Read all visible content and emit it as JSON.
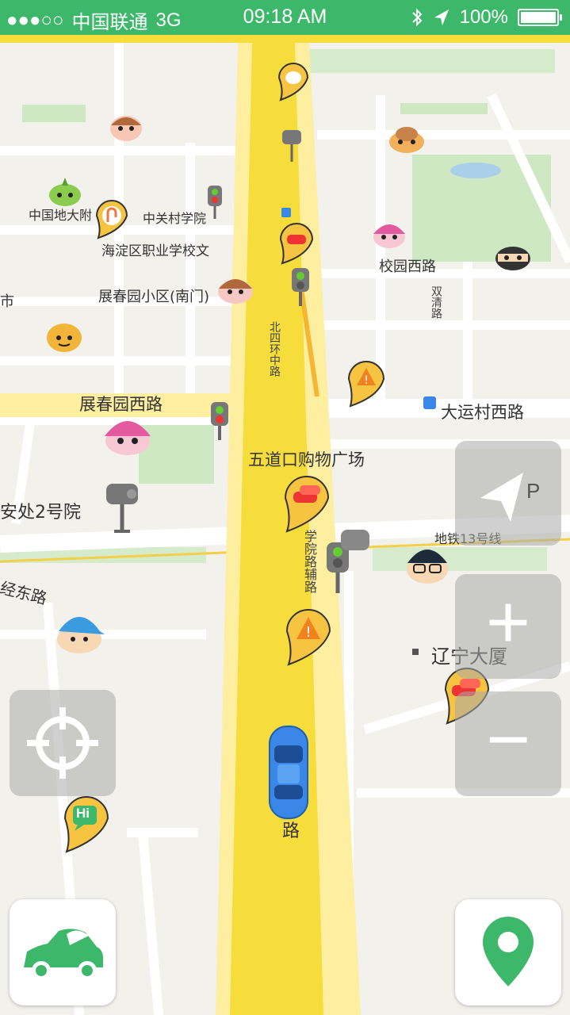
{
  "status_bar": {
    "signal": "●●●○○",
    "carrier": "中国联通",
    "network": "3G",
    "time": "09:18 AM",
    "battery": "100%"
  },
  "map_labels": {
    "cugb": "中国地大附",
    "zgc": "中关村学院",
    "haidian": "海淀区职业学校文",
    "xiaoyuan": "校园西路",
    "zhanchun_xiaoqu": "展春园小区(南门)",
    "shi": "市",
    "zhanchun_road": "展春园西路",
    "dayun": "大运村西路",
    "wudaokou_mall": "五道口购物广场",
    "anchu": "安处2号院",
    "metro13": "地铁13号线",
    "jingdong": "经东路",
    "liaoning": "辽宁大厦",
    "road_vertical_1": "北四环中路",
    "road_vertical_2": "学院路辅路",
    "road_vertical_3": "双清路",
    "main_road_bottom": "路"
  },
  "controls": {
    "hi_text": "Hi",
    "p_text": "P",
    "zoom_in_symbol": "+",
    "zoom_out_symbol": "−"
  },
  "colors": {
    "status_bar": "#3db86a",
    "road_main": "#f6dd3c",
    "road_side": "#fdeea0",
    "green_accent": "#3db86a",
    "car": "#3a87e8"
  }
}
